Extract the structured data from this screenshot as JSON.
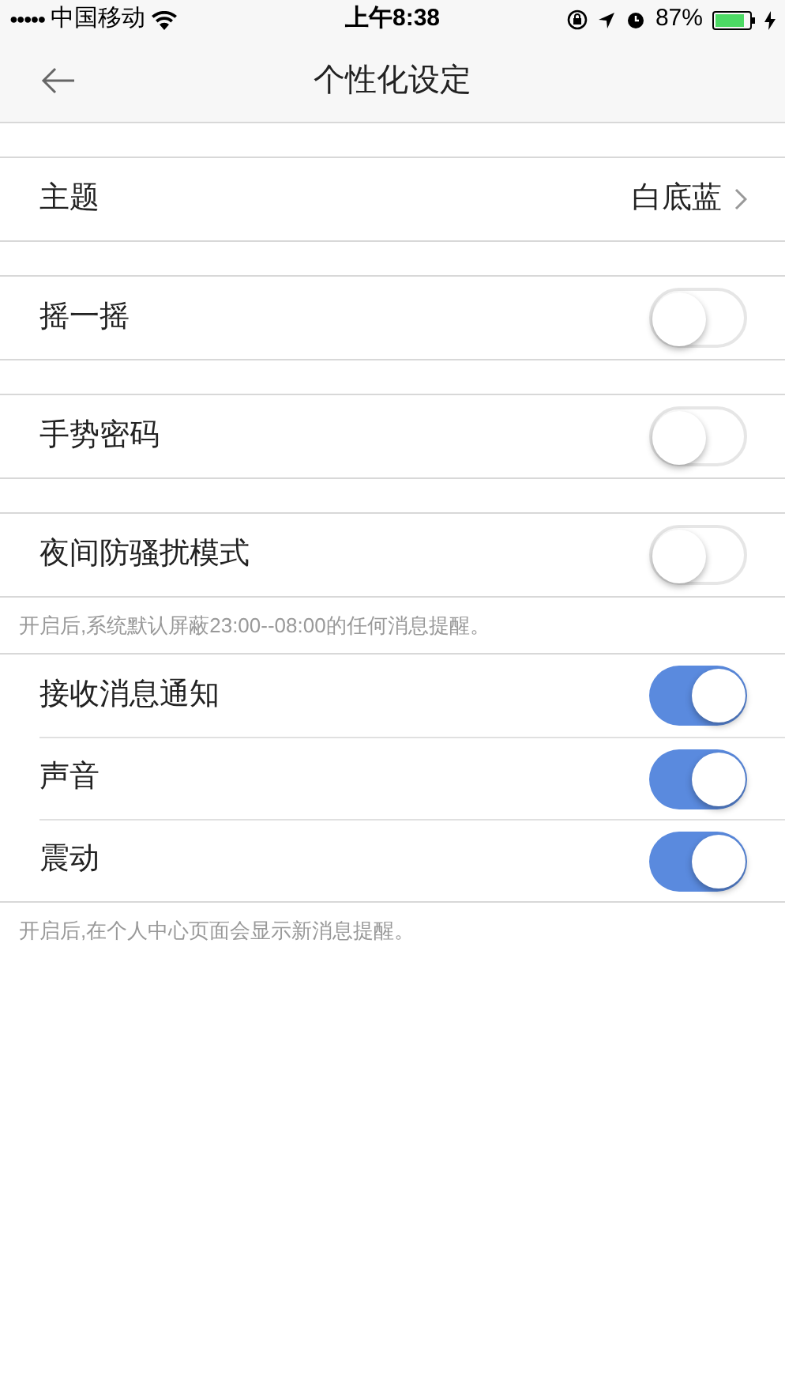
{
  "status_bar": {
    "signal_dots": "●●●●●",
    "carrier": "中国移动",
    "time": "上午8:38",
    "battery": "87%"
  },
  "nav": {
    "title": "个性化设定"
  },
  "groups": [
    {
      "rows": [
        {
          "kind": "link",
          "label": "主题",
          "value": "白底蓝"
        }
      ]
    },
    {
      "rows": [
        {
          "kind": "toggle",
          "label": "摇一摇",
          "on": false
        }
      ]
    },
    {
      "rows": [
        {
          "kind": "toggle",
          "label": "手势密码",
          "on": false
        }
      ]
    },
    {
      "rows": [
        {
          "kind": "toggle",
          "label": "夜间防骚扰模式",
          "on": false
        }
      ],
      "note": "开启后,系统默认屏蔽23:00--08:00的任何消息提醒。"
    },
    {
      "rows": [
        {
          "kind": "toggle",
          "label": "接收消息通知",
          "on": true
        },
        {
          "kind": "toggle",
          "label": "声音",
          "on": true
        },
        {
          "kind": "toggle",
          "label": "震动",
          "on": true
        }
      ],
      "note": "开启后,在个人中心页面会显示新消息提醒。"
    }
  ]
}
